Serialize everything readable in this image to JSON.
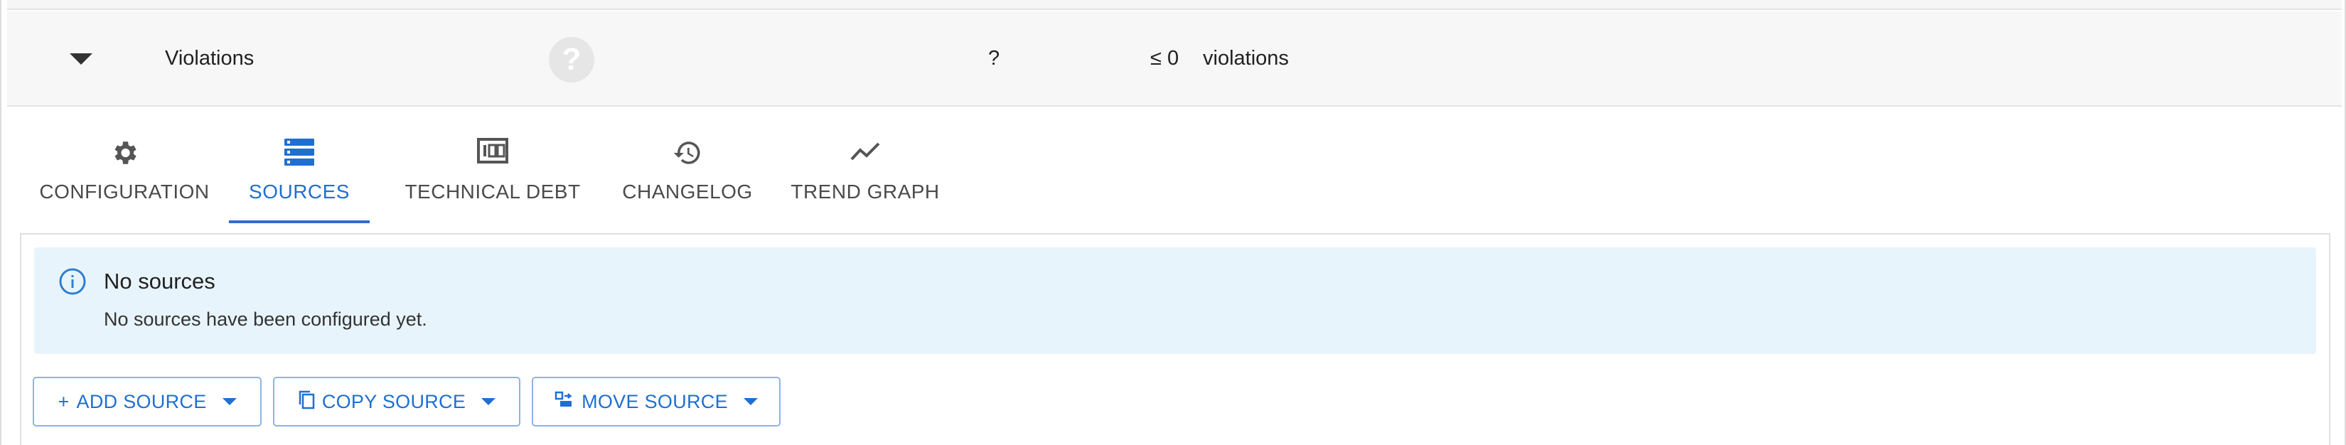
{
  "metric": {
    "name": "Violations",
    "help_icon": "question-circle-icon",
    "help_glyph": "?",
    "value": "?",
    "target": "≤ 0",
    "unit": "violations"
  },
  "tabs": [
    {
      "label": "CONFIGURATION",
      "icon": "gear-icon"
    },
    {
      "label": "SOURCES",
      "icon": "server-stack-icon",
      "active": true
    },
    {
      "label": "TECHNICAL DEBT",
      "icon": "money-icon"
    },
    {
      "label": "CHANGELOG",
      "icon": "history-icon"
    },
    {
      "label": "TREND GRAPH",
      "icon": "line-chart-icon"
    }
  ],
  "sources_panel": {
    "info_icon": "info-circle-icon",
    "info_title": "No sources",
    "info_text": "No sources have been configured yet.",
    "buttons": {
      "add": "ADD SOURCE",
      "add_prefix": "+",
      "copy": "COPY SOURCE",
      "move": "MOVE SOURCE"
    }
  },
  "colors": {
    "accent": "#1f6fd1",
    "info_bg": "#e8f4fb",
    "row_bg": "#f7f7f7"
  }
}
